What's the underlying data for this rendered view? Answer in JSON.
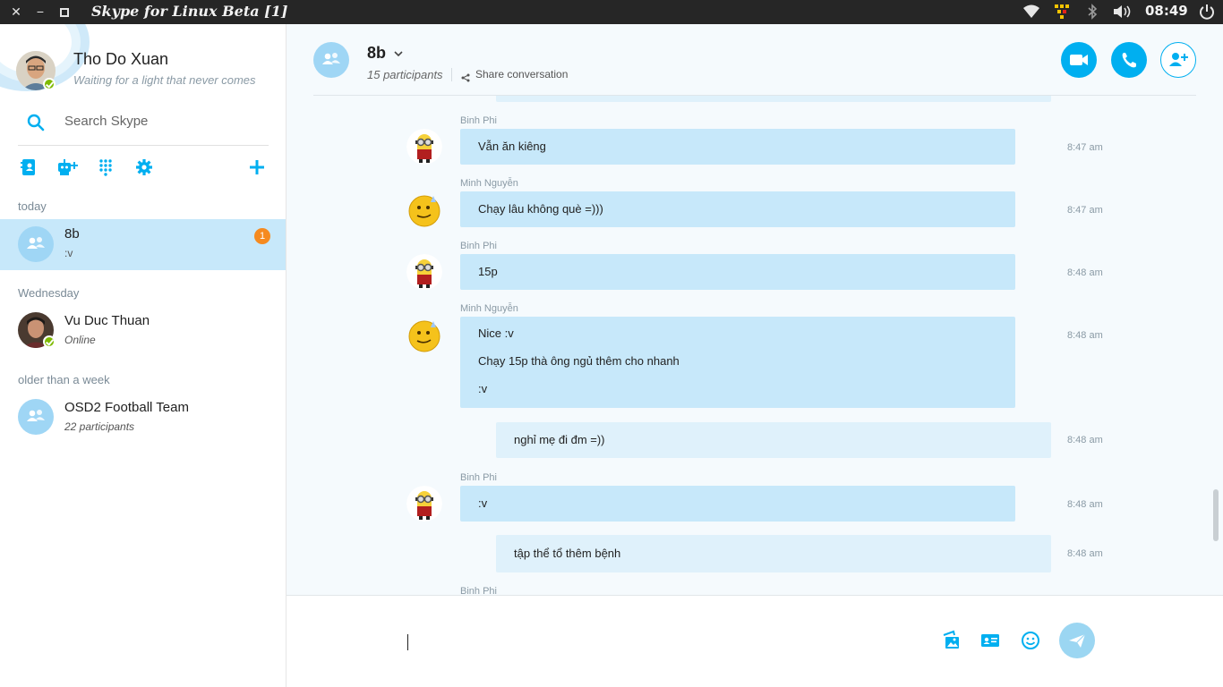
{
  "window": {
    "title": "Skype for Linux Beta [1]",
    "close_symbol": "✕",
    "minimize_symbol": "−",
    "maximize_symbol": "▫",
    "clock": "08:49"
  },
  "tray_icons": [
    "wifi-icon",
    "app-tray-icon",
    "bluetooth-icon",
    "volume-icon",
    "power-icon"
  ],
  "profile": {
    "name": "Tho Do Xuan",
    "mood": "Waiting for a light that never comes",
    "status": "online"
  },
  "search": {
    "placeholder": "Search Skype"
  },
  "toolbar_icons": [
    "contacts-icon",
    "add-bot-icon",
    "dialpad-icon",
    "settings-icon",
    "add-icon"
  ],
  "sections": {
    "today": "today",
    "wednesday": "Wednesday",
    "older": "older than a week"
  },
  "conversations": [
    {
      "name": "8b",
      "subtitle": ":v",
      "badge": "1"
    },
    {
      "name": "Vu Duc Thuan",
      "subtitle": "Online"
    },
    {
      "name": "OSD2 Football Team",
      "subtitle": "22 participants"
    }
  ],
  "chat": {
    "title": "8b",
    "participants": "15 participants",
    "share": "Share conversation"
  },
  "messages": [
    {
      "sender": "Binh Phi",
      "lines": [
        "Vẫn ăn kiêng"
      ],
      "time": "8:47 am"
    },
    {
      "sender": "Minh Nguyễn",
      "lines": [
        "Chạy lâu không què =)))"
      ],
      "time": "8:47 am"
    },
    {
      "sender": "Binh Phi",
      "lines": [
        "15p"
      ],
      "time": "8:48 am"
    },
    {
      "sender": "Minh Nguyễn",
      "lines": [
        "Nice :v",
        "Chạy 15p thà ông ngủ thêm cho nhanh",
        ":v"
      ],
      "time": "8:48 am"
    },
    {
      "sender": "",
      "lines": [
        "nghỉ mẹ đi đm =))"
      ],
      "time": "8:48 am"
    },
    {
      "sender": "Binh Phi",
      "lines": [
        ":v"
      ],
      "time": "8:48 am"
    },
    {
      "sender": "",
      "lines": [
        "tập thể tổ thêm bệnh"
      ],
      "time": "8:48 am"
    },
    {
      "sender": "Binh Phi",
      "lines": [],
      "time": ""
    }
  ],
  "composer_icons": [
    "media-gallery-icon",
    "contact-card-icon",
    "emoticon-icon",
    "send-icon"
  ],
  "colors": {
    "accent": "#00aff0",
    "bubble": "#c7e8fa",
    "active_row": "#c7e8fa",
    "badge": "#f58a1f",
    "online": "#7fba00"
  }
}
